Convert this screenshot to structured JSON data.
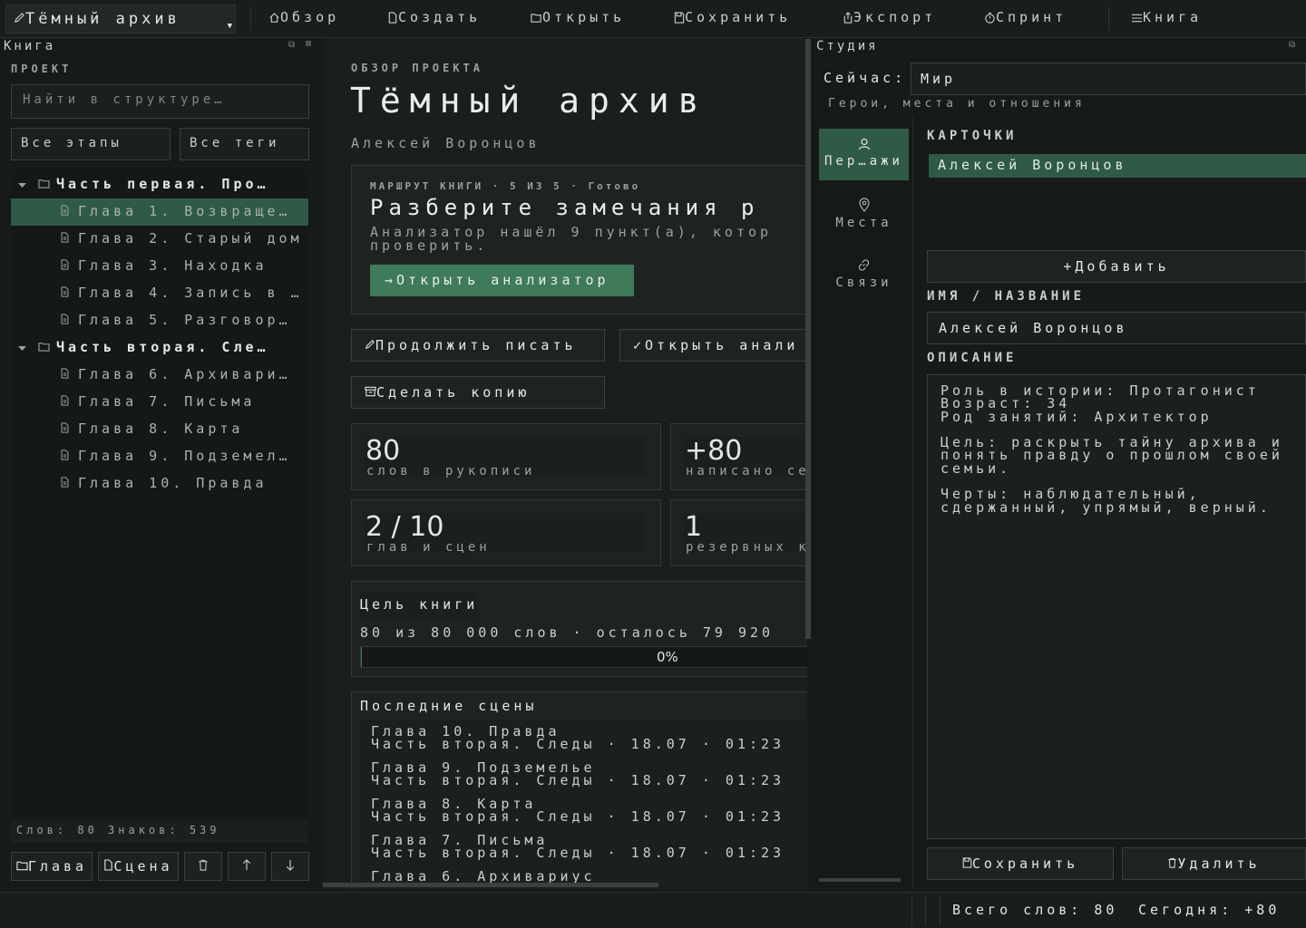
{
  "toolbar": {
    "project_select": "Тёмный архив",
    "overview": "Обзор",
    "create": "Создать",
    "open": "Открыть",
    "save": "Сохранить",
    "export": "Экспорт",
    "sprint": "Спринт",
    "book": "Книга"
  },
  "left": {
    "title": "Книга",
    "section": "ПРОЕКТ",
    "search_placeholder": "Найти в структуре…",
    "stages_filter": "Все этапы",
    "tags_filter": "Все теги",
    "tree": [
      {
        "kind": "part",
        "label": "Часть первая. Про…"
      },
      {
        "kind": "chapter",
        "label": "Глава 1. Возвраще…",
        "selected": true
      },
      {
        "kind": "chapter",
        "label": "Глава 2. Старый дом"
      },
      {
        "kind": "chapter",
        "label": "Глава 3. Находка"
      },
      {
        "kind": "chapter",
        "label": "Глава 4. Запись в …"
      },
      {
        "kind": "chapter",
        "label": "Глава 5. Разговор…"
      },
      {
        "kind": "part",
        "label": "Часть вторая. Сле…"
      },
      {
        "kind": "chapter",
        "label": "Глава 6. Архивари…"
      },
      {
        "kind": "chapter",
        "label": "Глава 7. Письма"
      },
      {
        "kind": "chapter",
        "label": "Глава 8. Карта"
      },
      {
        "kind": "chapter",
        "label": "Глава 9. Подземел…"
      },
      {
        "kind": "chapter",
        "label": "Глава 10. Правда"
      }
    ],
    "status": "Слов: 80  Знаков: 539",
    "btn_chapter": "Глава",
    "btn_scene": "Сцена"
  },
  "center": {
    "kicker": "ОБЗОР ПРОЕКТА",
    "title": "Тёмный архив",
    "author": "Алексей Воронцов",
    "route_meta": "МАРШРУТ КНИГИ · 5 ИЗ 5 · Готово",
    "route_title": "Разберите замечания р",
    "route_text": "Анализатор нашёл 9 пункт(а), котор проверить.",
    "route_button": "Открыть анализатор",
    "continue_button": "Продолжить писать",
    "open_analyzer_button": "Открыть анали",
    "copy_button": "Сделать копию",
    "stats": [
      {
        "value": "80",
        "label": "слов в рукописи"
      },
      {
        "value": "+80",
        "label": "написано се"
      },
      {
        "value": "2 / 10",
        "label": "глав и сцен"
      },
      {
        "value": "1",
        "label": "резервных к"
      }
    ],
    "goal_title": "Цель книги",
    "goal_text": "80 из 80 000 слов · осталось 79 920",
    "goal_progress": 0.001,
    "goal_percent": "0%",
    "recent_title": "Последние сцены",
    "recent": [
      {
        "title": "Глава 10. Правда",
        "meta": "Часть вторая. Следы · 18.07 · 01:23"
      },
      {
        "title": "Глава 9. Подземелье",
        "meta": "Часть вторая. Следы · 18.07 · 01:23"
      },
      {
        "title": "Глава 8. Карта",
        "meta": "Часть вторая. Следы · 18.07 · 01:23"
      },
      {
        "title": "Глава 7. Письма",
        "meta": "Часть вторая. Следы · 18.07 · 01:23"
      },
      {
        "title": "Глава 6. Архивариус",
        "meta": ""
      }
    ]
  },
  "right": {
    "title": "Студия",
    "now_label": "Сейчас:",
    "now_value": "Мир",
    "subtitle": "Герои, места и отношения",
    "tabs": [
      {
        "label": "Пер…ажи",
        "icon": "person-icon"
      },
      {
        "label": "Места",
        "icon": "map-pin-icon"
      },
      {
        "label": "Связи",
        "icon": "link-icon"
      }
    ],
    "cards_label": "КАРТОЧКИ",
    "cards": [
      "Алексей Воронцов"
    ],
    "add_button": "Добавить",
    "name_label": "ИМЯ / НАЗВАНИЕ",
    "name_value": "Алексей Воронцов",
    "desc_label": "ОПИСАНИЕ",
    "description": "Роль в истории: Протагонист\nВозраст: 34\nРод занятий: Архитектор\n\nЦель: раскрыть тайну архива и\nпонять правду о прошлом своей\nсемьи.\n\nЧерты: наблюдательный,\nсдержанный, упрямый, верный.",
    "save_button": "Сохранить",
    "delete_button": "Удалить"
  },
  "statusbar": {
    "total": "Всего слов: 80",
    "today": "Сегодня: +80"
  },
  "colors": {
    "accent": "#3f7a5a",
    "selection": "#2f5a45",
    "background": "#161a19"
  }
}
